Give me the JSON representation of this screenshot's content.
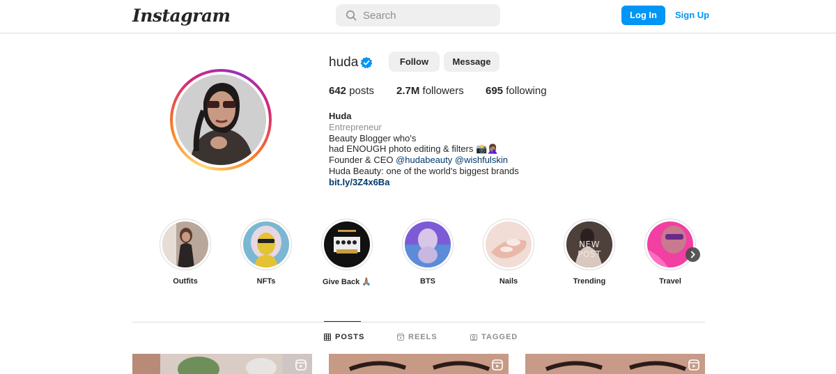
{
  "header": {
    "logo_text": "Instagram",
    "search_placeholder": "Search",
    "login_label": "Log In",
    "signup_label": "Sign Up"
  },
  "profile": {
    "username": "huda",
    "verified": true,
    "follow_label": "Follow",
    "message_label": "Message",
    "stats": {
      "posts_count": "642",
      "posts_label": "posts",
      "followers_count": "2.7M",
      "followers_label": "followers",
      "following_count": "695",
      "following_label": "following"
    },
    "bio": {
      "name": "Huda",
      "category": "Entrepreneur",
      "line1": "Beauty Blogger who's",
      "line2": "had ENOUGH photo editing & filters 📸🤦🏽‍♀️",
      "line3_prefix": "Founder & CEO ",
      "mention1": "@hudabeauty",
      "mention2": "@wishfulskin",
      "line4": "Huda Beauty: one of the world's biggest brands",
      "link": "bit.ly/3Z4x6Ba"
    }
  },
  "highlights": [
    {
      "label": "Outfits"
    },
    {
      "label": "NFTs"
    },
    {
      "label": "Give Back 🙏🏽"
    },
    {
      "label": "BTS"
    },
    {
      "label": "Nails"
    },
    {
      "label": "Trending",
      "overlay_text": "NEW POST"
    },
    {
      "label": "Travel"
    }
  ],
  "tabs": [
    {
      "label": "POSTS",
      "active": true
    },
    {
      "label": "REELS",
      "active": false
    },
    {
      "label": "TAGGED",
      "active": false
    }
  ],
  "colors": {
    "accent": "#0095f6",
    "verified": "#0095f6",
    "link": "#00376b",
    "muted": "#8e8e8e",
    "border": "#dbdbdb"
  },
  "icons": {
    "search": "search-icon",
    "verified": "verified-badge-icon",
    "grid": "grid-icon",
    "reels": "reels-icon",
    "tagged": "tagged-icon",
    "reel_badge": "reel-icon",
    "next": "chevron-right-icon"
  }
}
